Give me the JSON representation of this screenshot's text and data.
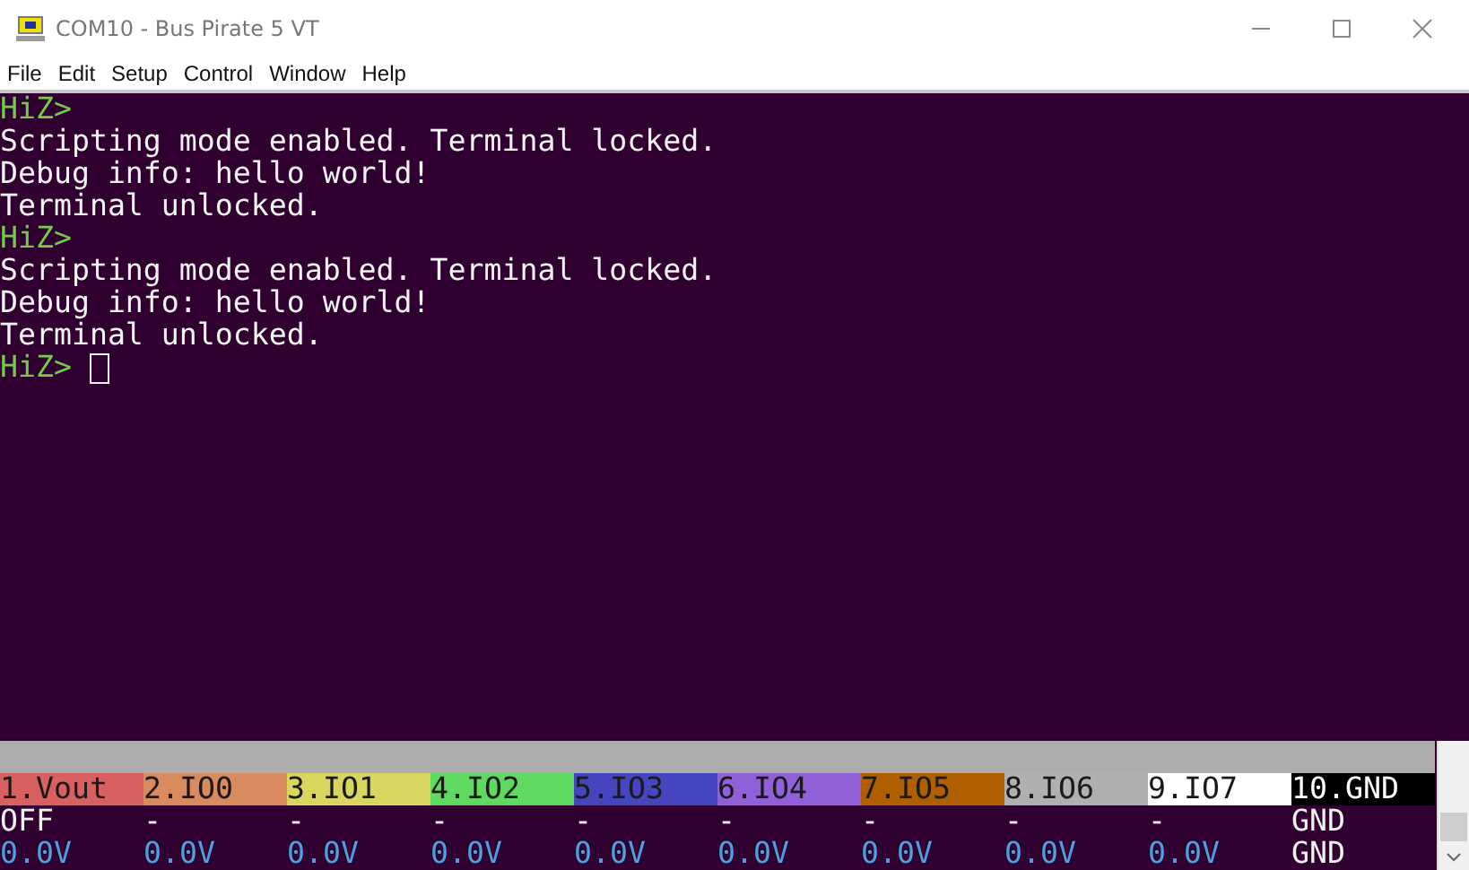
{
  "window": {
    "title": "COM10 - Bus Pirate 5 VT"
  },
  "menu": [
    "File",
    "Edit",
    "Setup",
    "Control",
    "Window",
    "Help"
  ],
  "terminal": {
    "lines": [
      {
        "kind": "prompt",
        "text": "HiZ>"
      },
      {
        "kind": "output",
        "text": "Scripting mode enabled. Terminal locked."
      },
      {
        "kind": "output",
        "text": "Debug info: hello world!"
      },
      {
        "kind": "output",
        "text": "Terminal unlocked."
      },
      {
        "kind": "prompt",
        "text": "HiZ>"
      },
      {
        "kind": "output",
        "text": "Scripting mode enabled. Terminal locked."
      },
      {
        "kind": "output",
        "text": "Debug info: hello world!"
      },
      {
        "kind": "output",
        "text": "Terminal unlocked."
      },
      {
        "kind": "prompt",
        "text": "HiZ> ",
        "cursor": true
      }
    ]
  },
  "status_bar": {
    "pins": [
      {
        "label": "1.Vout",
        "color": "#d96060",
        "kind": "io",
        "state": "OFF",
        "voltage": "0.0V"
      },
      {
        "label": "2.IO0",
        "color": "#d98a5f",
        "kind": "io",
        "state": "-",
        "voltage": "0.0V"
      },
      {
        "label": "3.IO1",
        "color": "#d9d65f",
        "kind": "io",
        "state": "-",
        "voltage": "0.0V"
      },
      {
        "label": "4.IO2",
        "color": "#5fd95f",
        "kind": "io",
        "state": "-",
        "voltage": "0.0V"
      },
      {
        "label": "5.IO3",
        "color": "#4545c0",
        "kind": "io",
        "state": "-",
        "voltage": "0.0V"
      },
      {
        "label": "6.IO4",
        "color": "#9060d9",
        "kind": "io",
        "state": "-",
        "voltage": "0.0V"
      },
      {
        "label": "7.IO5",
        "color": "#b05f00",
        "kind": "io",
        "state": "-",
        "voltage": "0.0V"
      },
      {
        "label": "8.IO6",
        "color": "#b0b0b0",
        "kind": "io",
        "state": "-",
        "voltage": "0.0V"
      },
      {
        "label": "9.IO7",
        "color": "#ffffff",
        "kind": "io",
        "state": "-",
        "voltage": "0.0V"
      },
      {
        "label": "10.GND",
        "color": "#000000",
        "kind": "ground",
        "state": "GND",
        "voltage": "GND"
      }
    ]
  }
}
